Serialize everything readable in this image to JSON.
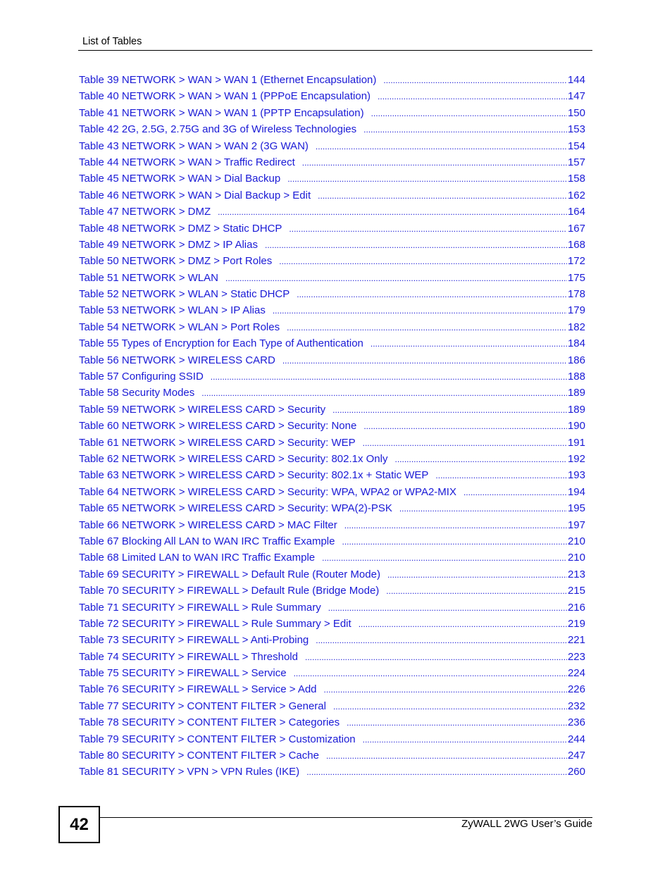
{
  "header": {
    "section_title": "List of Tables"
  },
  "entries": [
    {
      "label": "Table 39 NETWORK > WAN > WAN 1 (Ethernet Encapsulation)",
      "page": "144"
    },
    {
      "label": "Table 40 NETWORK > WAN > WAN 1 (PPPoE Encapsulation)",
      "page": "147"
    },
    {
      "label": "Table 41 NETWORK > WAN > WAN 1 (PPTP Encapsulation)",
      "page": "150"
    },
    {
      "label": "Table 42 2G, 2.5G, 2.75G and 3G of Wireless Technologies",
      "page": "153"
    },
    {
      "label": "Table 43 NETWORK > WAN > WAN 2 (3G WAN)",
      "page": "154"
    },
    {
      "label": "Table 44 NETWORK > WAN > Traffic Redirect",
      "page": "157"
    },
    {
      "label": "Table 45 NETWORK > WAN > Dial Backup",
      "page": "158"
    },
    {
      "label": "Table 46 NETWORK > WAN > Dial Backup > Edit",
      "page": "162"
    },
    {
      "label": "Table 47 NETWORK > DMZ",
      "page": "164"
    },
    {
      "label": "Table 48 NETWORK > DMZ > Static DHCP",
      "page": "167"
    },
    {
      "label": "Table 49 NETWORK > DMZ > IP Alias",
      "page": "168"
    },
    {
      "label": "Table 50 NETWORK > DMZ > Port Roles",
      "page": "172"
    },
    {
      "label": "Table 51 NETWORK > WLAN",
      "page": "175"
    },
    {
      "label": "Table 52 NETWORK > WLAN > Static DHCP",
      "page": "178"
    },
    {
      "label": "Table 53 NETWORK > WLAN > IP Alias",
      "page": "179"
    },
    {
      "label": "Table 54 NETWORK > WLAN > Port Roles",
      "page": "182"
    },
    {
      "label": "Table 55 Types of Encryption for Each Type of Authentication",
      "page": "184"
    },
    {
      "label": "Table 56 NETWORK > WIRELESS CARD",
      "page": "186"
    },
    {
      "label": "Table 57 Configuring SSID",
      "page": "188"
    },
    {
      "label": "Table 58 Security Modes",
      "page": "189"
    },
    {
      "label": "Table 59 NETWORK > WIRELESS CARD > Security",
      "page": "189"
    },
    {
      "label": "Table 60 NETWORK > WIRELESS CARD > Security: None",
      "page": "190"
    },
    {
      "label": "Table 61 NETWORK > WIRELESS CARD > Security: WEP",
      "page": "191"
    },
    {
      "label": "Table 62 NETWORK > WIRELESS CARD > Security: 802.1x Only",
      "page": "192"
    },
    {
      "label": "Table 63 NETWORK > WIRELESS CARD > Security: 802.1x + Static WEP",
      "page": "193"
    },
    {
      "label": "Table 64 NETWORK > WIRELESS CARD > Security: WPA, WPA2 or WPA2-MIX",
      "page": "194"
    },
    {
      "label": "Table 65 NETWORK > WIRELESS CARD > Security: WPA(2)-PSK",
      "page": "195"
    },
    {
      "label": "Table 66 NETWORK > WIRELESS CARD > MAC Filter",
      "page": "197"
    },
    {
      "label": "Table 67 Blocking All LAN to WAN IRC Traffic Example",
      "page": "210"
    },
    {
      "label": "Table 68 Limited LAN to WAN IRC Traffic Example",
      "page": "210"
    },
    {
      "label": "Table 69 SECURITY > FIREWALL > Default Rule (Router Mode)",
      "page": "213"
    },
    {
      "label": "Table 70 SECURITY > FIREWALL > Default Rule (Bridge Mode)",
      "page": "215"
    },
    {
      "label": "Table 71 SECURITY > FIREWALL > Rule Summary",
      "page": "216"
    },
    {
      "label": "Table 72 SECURITY > FIREWALL > Rule Summary > Edit",
      "page": "219"
    },
    {
      "label": "Table 73 SECURITY > FIREWALL > Anti-Probing",
      "page": "221"
    },
    {
      "label": "Table 74 SECURITY > FIREWALL > Threshold",
      "page": "223"
    },
    {
      "label": "Table 75 SECURITY > FIREWALL > Service",
      "page": "224"
    },
    {
      "label": "Table 76 SECURITY > FIREWALL > Service > Add",
      "page": "226"
    },
    {
      "label": "Table 77 SECURITY > CONTENT FILTER > General",
      "page": "232"
    },
    {
      "label": "Table 78 SECURITY > CONTENT FILTER > Categories",
      "page": "236"
    },
    {
      "label": "Table 79 SECURITY > CONTENT FILTER > Customization",
      "page": "244"
    },
    {
      "label": "Table 80 SECURITY > CONTENT FILTER > Cache",
      "page": "247"
    },
    {
      "label": "Table 81 SECURITY > VPN > VPN Rules (IKE)",
      "page": "260"
    }
  ],
  "footer": {
    "page_number": "42",
    "guide_title": "ZyWALL 2WG User’s Guide"
  },
  "colors": {
    "link": "#1a1ad6",
    "text": "#000000"
  }
}
